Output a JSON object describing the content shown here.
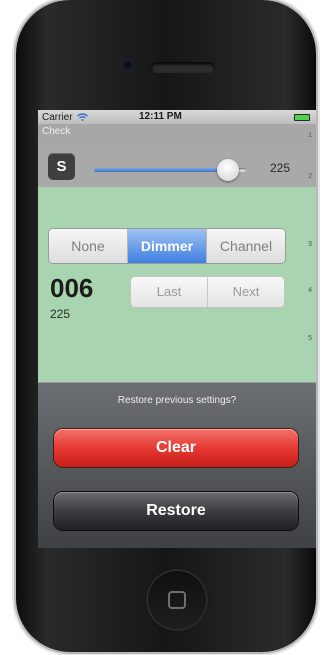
{
  "status_bar": {
    "carrier": "Carrier",
    "time": "12:11 PM"
  },
  "nav": {
    "title": "Check"
  },
  "slider_row": {
    "button_label": "S",
    "value_text": "225",
    "level": 0.88
  },
  "row_numbers": [
    "1",
    "2",
    "3",
    "4",
    "5"
  ],
  "segments": {
    "options": [
      "None",
      "Dimmer",
      "Channel"
    ],
    "selected": "Dimmer"
  },
  "channel": {
    "number": "006",
    "value": "225"
  },
  "nav_segments": {
    "options": [
      "Last",
      "Next"
    ]
  },
  "action_sheet": {
    "message": "Restore previous settings?",
    "clear_label": "Clear",
    "restore_label": "Restore"
  },
  "colors": {
    "accent_blue": "#3e7fe0",
    "destructive_red": "#e63a33",
    "background_green": "#a8d4b0"
  }
}
